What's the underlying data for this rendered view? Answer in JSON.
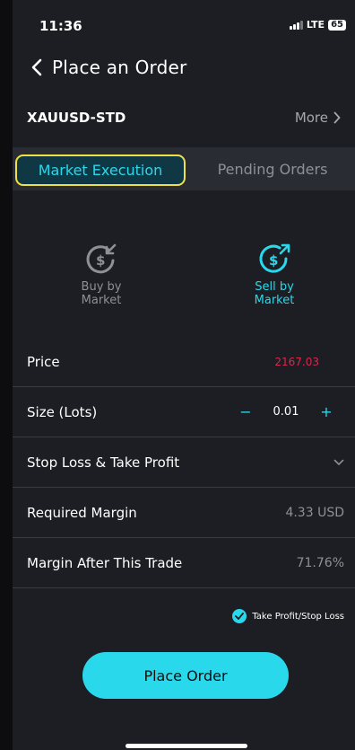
{
  "status": {
    "time": "11:36",
    "network": "LTE",
    "battery": "65"
  },
  "header": {
    "title": "Place an Order"
  },
  "symbol": {
    "name": "XAUUSD-STD",
    "more_label": "More"
  },
  "tabs": [
    {
      "label": "Market Execution",
      "active": true
    },
    {
      "label": "Pending Orders",
      "active": false
    }
  ],
  "direction": {
    "buy_label": "Buy by\nMarket",
    "sell_label": "Sell by\nMarket",
    "selected": "sell"
  },
  "rows": {
    "price": {
      "label": "Price",
      "value": "2167.03"
    },
    "size": {
      "label": "Size (Lots)",
      "value": "0.01",
      "minus": "−",
      "plus": "+"
    },
    "sltp": {
      "label": "Stop Loss & Take Profit"
    },
    "required_margin": {
      "label": "Required Margin",
      "value": "4.33 USD"
    },
    "margin_after": {
      "label": "Margin After This Trade",
      "value": "71.76%"
    }
  },
  "tpsl_option": {
    "label": "Take Profit/Stop Loss",
    "checked": true
  },
  "place_button": {
    "label": "Place Order"
  },
  "colors": {
    "accent": "#2ad8ec",
    "sell_price": "#d8284e",
    "highlight_border": "#f0e046"
  }
}
